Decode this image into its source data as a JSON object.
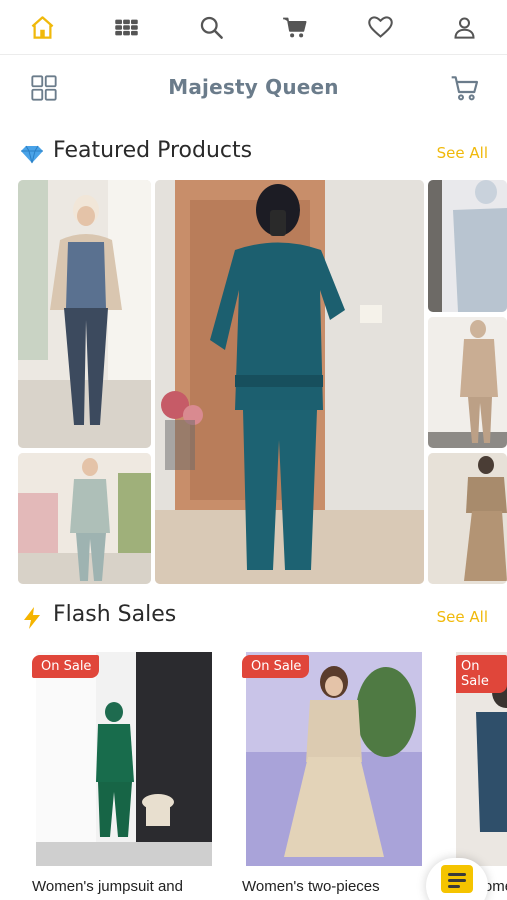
{
  "topnav": {
    "items": [
      {
        "icon": "home-icon",
        "active": true
      },
      {
        "icon": "categories-grid-icon"
      },
      {
        "icon": "search-icon"
      },
      {
        "icon": "cart-icon"
      },
      {
        "icon": "heart-icon"
      },
      {
        "icon": "user-icon"
      }
    ],
    "active_color": "#f0b90b",
    "icon_color": "#555555"
  },
  "header": {
    "title": "Majesty Queen",
    "left_icon": "grid-menu-icon",
    "right_icon": "cart-outline-icon"
  },
  "featured": {
    "icon": "diamond-icon",
    "title": "Featured Products",
    "see_all": "See All"
  },
  "flash": {
    "icon": "lightning-icon",
    "title": "Flash Sales",
    "see_all": "See All",
    "products": [
      {
        "badge": "On Sale",
        "name": "Women's jumpsuit and"
      },
      {
        "badge": "On Sale",
        "name": "Women's two-pieces"
      },
      {
        "badge": "On Sale",
        "name": "Women's suit"
      }
    ]
  },
  "chat": {
    "icon": "chat-icon"
  },
  "colors": {
    "accent": "#f0b90b",
    "sale_badge": "#e0463a",
    "title": "#6b7c8b"
  }
}
